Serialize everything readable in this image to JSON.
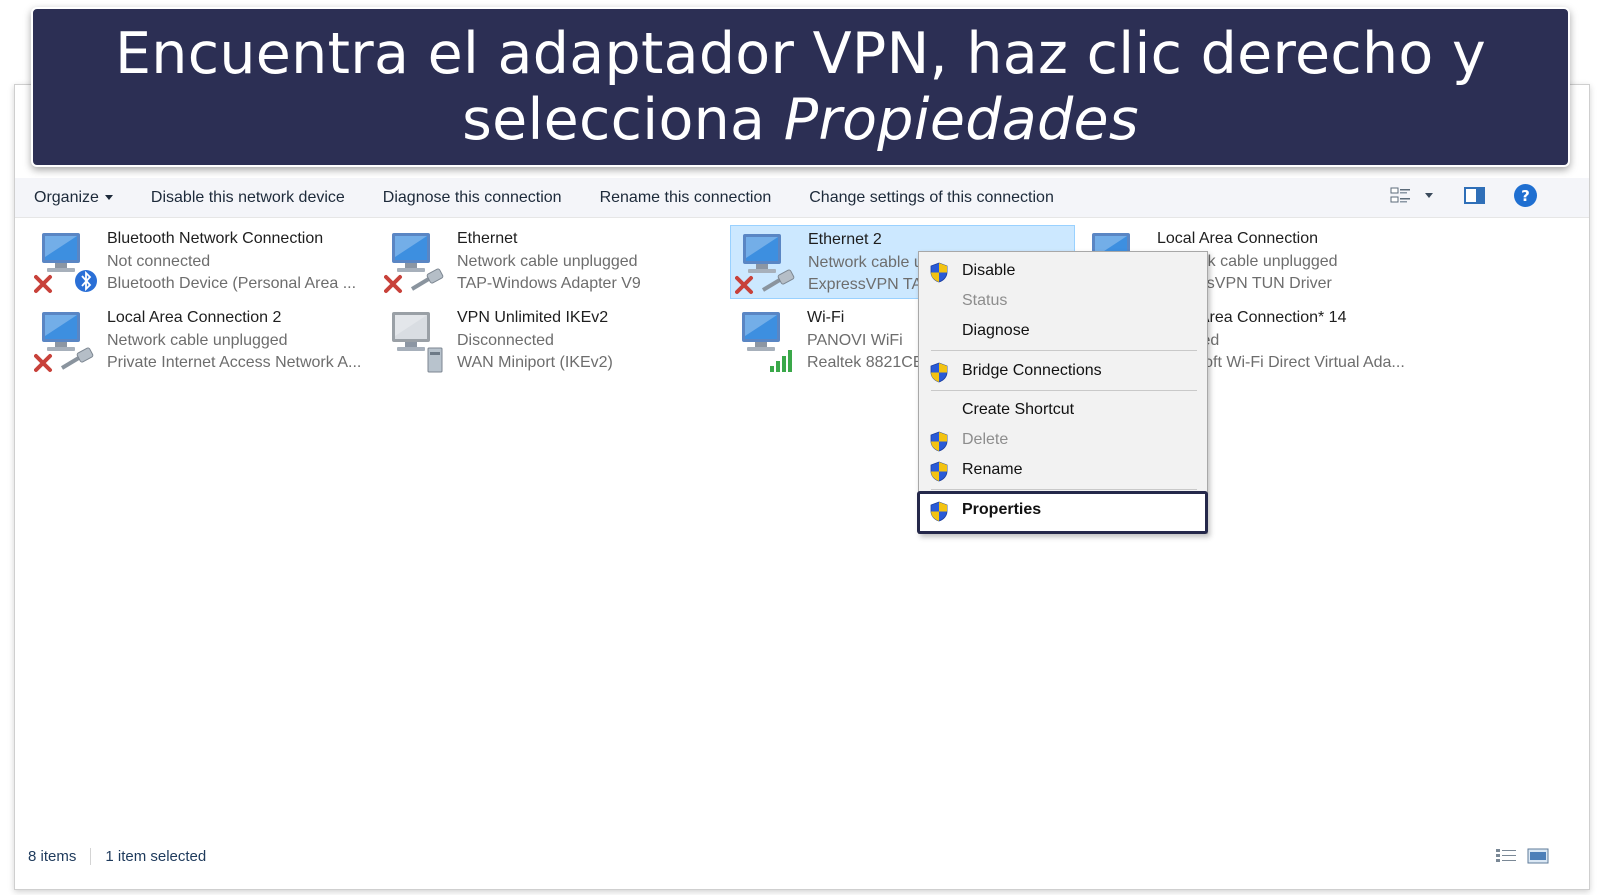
{
  "banner": {
    "line1": "Encuentra el adaptador VPN, haz clic derecho y",
    "line2_prefix": "selecciona ",
    "line2_em": "Propiedades"
  },
  "toolbar": {
    "organize": "Organize",
    "disable_device": "Disable this network device",
    "diagnose": "Diagnose this connection",
    "rename": "Rename this connection",
    "change_settings": "Change settings of this connection",
    "help_glyph": "?"
  },
  "items": [
    {
      "name": "Bluetooth Network Connection",
      "status": "Not connected",
      "device": "Bluetooth Device (Personal Area ...",
      "icon": "network-disconnected-bluetooth-icon"
    },
    {
      "name": "Ethernet",
      "status": "Network cable unplugged",
      "device": "TAP-Windows Adapter V9",
      "icon": "network-cable-unplugged-icon"
    },
    {
      "name": "Ethernet 2",
      "status": "Network cable unplugged",
      "device": "ExpressVPN TAP Adapter",
      "icon": "network-cable-unplugged-icon",
      "selected": true
    },
    {
      "name": "Local Area Connection",
      "status": "Network cable unplugged",
      "device": "ExpressVPN TUN Driver",
      "icon": "network-adapter-icon"
    },
    {
      "name": "Local Area Connection 2",
      "status": "Network cable unplugged",
      "device": "Private Internet Access Network A...",
      "icon": "network-cable-unplugged-icon"
    },
    {
      "name": "VPN Unlimited IKEv2",
      "status": "Disconnected",
      "device": "WAN Miniport (IKEv2)",
      "icon": "vpn-connection-icon"
    },
    {
      "name": "Wi-Fi",
      "status": "PANOVI WiFi",
      "device": "Realtek 8821CE Wireless LAN",
      "icon": "wifi-signal-icon"
    },
    {
      "name": "Local Area Connection* 14",
      "status": "Disabled",
      "device": "Microsoft Wi-Fi Direct Virtual Ada...",
      "icon": "network-adapter-icon"
    }
  ],
  "context_menu": {
    "disable": "Disable",
    "status": "Status",
    "diagnose": "Diagnose",
    "bridge": "Bridge Connections",
    "shortcut": "Create Shortcut",
    "delete": "Delete",
    "rename": "Rename",
    "properties": "Properties"
  },
  "statusbar": {
    "items_count": "8 items",
    "selected": "1 item selected"
  },
  "colors": {
    "banner_bg": "#2c2f54",
    "selection_bg": "#cce8ff",
    "highlight_border": "#25284a",
    "shield_blue": "#2a5bd7",
    "shield_yellow": "#f3c312"
  }
}
